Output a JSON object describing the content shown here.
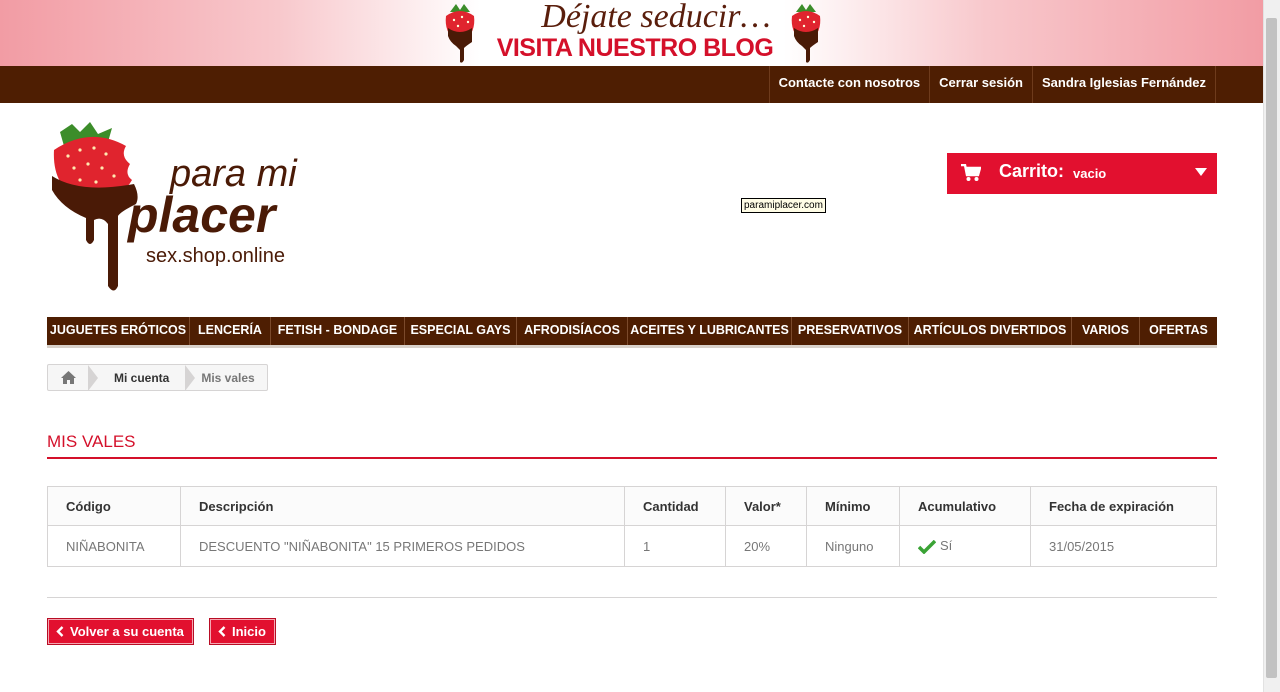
{
  "banner": {
    "tagline": "Déjate seducir…",
    "cta": "VISITA NUESTRO BLOG"
  },
  "topbar": {
    "links": [
      "Contacte con nosotros",
      "Cerrar sesión",
      "Sandra Iglesias Fernández"
    ]
  },
  "logo": {
    "line1": "para mi",
    "line2": "placer",
    "line3": "sex.shop.online"
  },
  "domain_tag": "paramiplacer.com",
  "cart": {
    "label": "Carrito:",
    "status": "vacio"
  },
  "menu": {
    "items": [
      "JUGUETES ERÓTICOS",
      "LENCERÍA",
      "FETISH - BONDAGE",
      "ESPECIAL GAYS",
      "AFRODISÍACOS",
      "ACEITES Y LUBRICANTES",
      "PRESERVATIVOS",
      "ARTÍCULOS DIVERTIDOS",
      "VARIOS",
      "OFERTAS"
    ]
  },
  "breadcrumb": {
    "parent": "Mi cuenta",
    "current": "Mis vales"
  },
  "page": {
    "title": "MIS VALES"
  },
  "vouchers": {
    "headers": [
      "Código",
      "Descripción",
      "Cantidad",
      "Valor*",
      "Mínimo",
      "Acumulativo",
      "Fecha de expiración"
    ],
    "rows": [
      {
        "code": "NIÑABONITA",
        "description": "DESCUENTO \"NIÑABONITA\" 15 PRIMEROS PEDIDOS",
        "quantity": "1",
        "value": "20%",
        "minimum": "Ninguno",
        "cumulative": "Sí",
        "expiry": "31/05/2015"
      }
    ]
  },
  "buttons": {
    "back_account": "Volver a su cuenta",
    "home": "Inicio"
  },
  "colors": {
    "brand_red": "#e2102f",
    "brand_brown": "#4e1e02",
    "check_green": "#3aa335"
  }
}
